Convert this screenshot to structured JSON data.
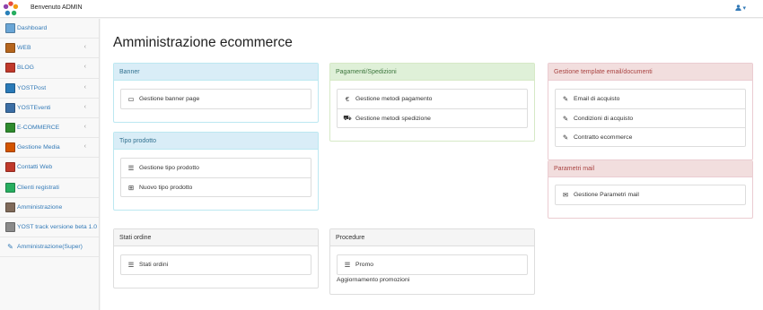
{
  "header": {
    "welcome": "Benvenuto ADMIN",
    "user_icon": "user-icon",
    "caret": "▾"
  },
  "sidebar": {
    "items": [
      {
        "label": "Dashboard",
        "icon": "dashboard-icon",
        "color": "#6aa6d6",
        "chevron": false
      },
      {
        "label": "WEB",
        "icon": "web-icon",
        "color": "#b5651d",
        "chevron": true
      },
      {
        "label": "BLOG",
        "icon": "blog-icon",
        "color": "#c0392b",
        "chevron": true
      },
      {
        "label": "YOSTPost",
        "icon": "post-icon",
        "color": "#2a7ab8",
        "chevron": true
      },
      {
        "label": "YOSTEventi",
        "icon": "events-icon",
        "color": "#3b6ea5",
        "chevron": true
      },
      {
        "label": "E-COMMERCE",
        "icon": "ecommerce-icon",
        "color": "#2e8b2e",
        "chevron": true
      },
      {
        "label": "Gestione Media",
        "icon": "media-icon",
        "color": "#d35400",
        "chevron": true
      },
      {
        "label": "Contatti Web",
        "icon": "contacts-icon",
        "color": "#c0392b",
        "chevron": false
      },
      {
        "label": "Clienti registrati",
        "icon": "clients-icon",
        "color": "#27ae60",
        "chevron": false
      },
      {
        "label": "Amministrazione",
        "icon": "admin-icon",
        "color": "#7f6a5a",
        "chevron": false
      },
      {
        "label": "YOST track versione beta 1.0",
        "icon": "track-icon",
        "color": "#8a8a8a",
        "chevron": false
      },
      {
        "label": "Amministrazione(Super)",
        "icon": "wrench-icon",
        "color": "#337ab7",
        "chevron": false
      }
    ],
    "chevron": "‹"
  },
  "main": {
    "title": "Amministrazione ecommerce"
  },
  "panels": {
    "banner": {
      "title": "Banner",
      "items": [
        {
          "label": "Gestione banner page",
          "icon": "monitor-icon",
          "glyph": "▭"
        }
      ]
    },
    "tipo": {
      "title": "Tipo prodotto",
      "items": [
        {
          "label": "Gestione tipo prodotto",
          "icon": "list-icon",
          "glyph": "☰"
        },
        {
          "label": "Nuovo tipo prodotto",
          "icon": "plus-square-icon",
          "glyph": "⊞"
        }
      ]
    },
    "stati": {
      "title": "Stati ordine",
      "items": [
        {
          "label": "Stati ordini",
          "icon": "list-icon",
          "glyph": "☰"
        }
      ]
    },
    "pagamenti": {
      "title": "Pagamenti/Spedizioni",
      "items": [
        {
          "label": "Gestione metodi pagamento",
          "icon": "euro-icon",
          "glyph": "€"
        },
        {
          "label": "Gestione metodi spedizione",
          "icon": "truck-icon",
          "glyph": "⛟"
        }
      ]
    },
    "procedure": {
      "title": "Procedure",
      "items": [
        {
          "label": "Promo",
          "icon": "list-icon",
          "glyph": "☰"
        }
      ],
      "note": "Aggiornamento promozioni"
    },
    "email": {
      "title": "Gestione template email/documenti",
      "items": [
        {
          "label": "Email di acquisto",
          "icon": "edit-icon",
          "glyph": "✎"
        },
        {
          "label": "Condizioni di acquisto",
          "icon": "edit-icon",
          "glyph": "✎"
        },
        {
          "label": "Contratto ecommerce",
          "icon": "edit-icon",
          "glyph": "✎"
        }
      ]
    },
    "mail": {
      "title": "Parametri mail",
      "items": [
        {
          "label": "Gestione Parametri mail",
          "icon": "envelope-icon",
          "glyph": "✉"
        }
      ]
    }
  }
}
